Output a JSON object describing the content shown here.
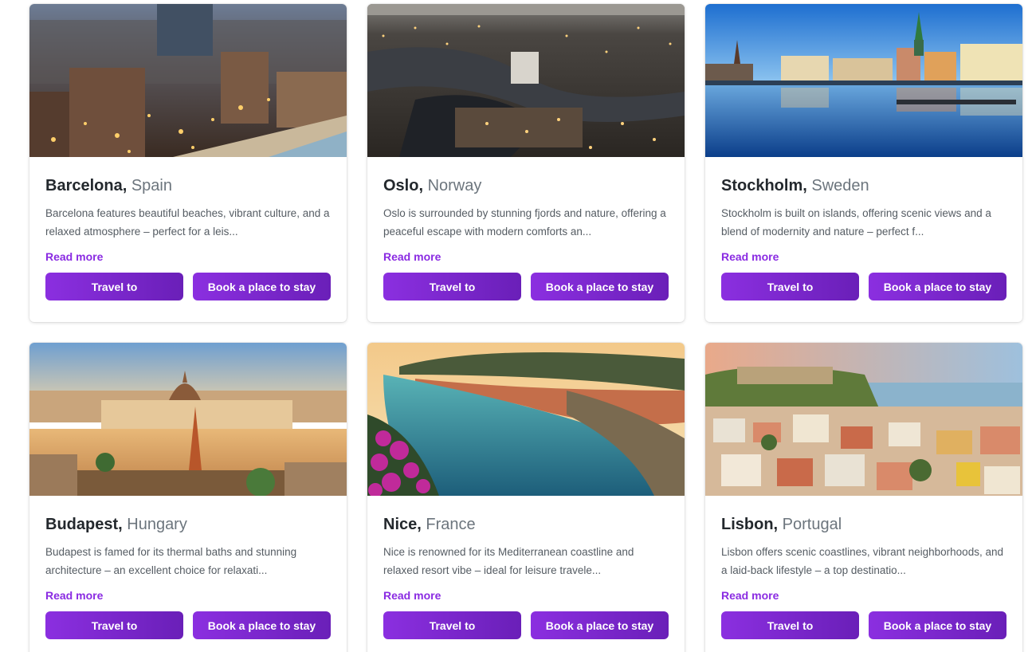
{
  "cards": [
    {
      "city": "Barcelona",
      "separator": ",",
      "country": "Spain",
      "description": "Barcelona features beautiful beaches, vibrant culture, and a relaxed atmosphere – perfect for a leis...",
      "read_more": "Read more",
      "travel_label": "Travel to",
      "book_label": "Book a place to stay"
    },
    {
      "city": "Oslo",
      "separator": ",",
      "country": "Norway",
      "description": "Oslo is surrounded by stunning fjords and nature, offering a peaceful escape with modern comforts an...",
      "read_more": "Read more",
      "travel_label": "Travel to",
      "book_label": "Book a place to stay"
    },
    {
      "city": "Stockholm",
      "separator": ",",
      "country": "Sweden",
      "description": "Stockholm is built on islands, offering scenic views and a blend of modernity and nature – perfect f...",
      "read_more": "Read more",
      "travel_label": "Travel to",
      "book_label": "Book a place to stay"
    },
    {
      "city": "Budapest",
      "separator": ",",
      "country": "Hungary",
      "description": "Budapest is famed for its thermal baths and stunning architecture – an excellent choice for relaxati...",
      "read_more": "Read more",
      "travel_label": "Travel to",
      "book_label": "Book a place to stay"
    },
    {
      "city": "Nice",
      "separator": ",",
      "country": "France",
      "description": "Nice is renowned for its Mediterranean coastline and relaxed resort vibe – ideal for leisure travele...",
      "read_more": "Read more",
      "travel_label": "Travel to",
      "book_label": "Book a place to stay"
    },
    {
      "city": "Lisbon",
      "separator": ",",
      "country": "Portugal",
      "description": "Lisbon offers scenic coastlines, vibrant neighborhoods, and a laid-back lifestyle – a top destinatio...",
      "read_more": "Read more",
      "travel_label": "Travel to",
      "book_label": "Book a place to stay"
    }
  ],
  "colors": {
    "accent": "#8a2be2",
    "button_start": "#8b2fe0",
    "button_end": "#6a1fb8",
    "title": "#23282d",
    "country": "#6c757d",
    "description": "#555c63"
  }
}
